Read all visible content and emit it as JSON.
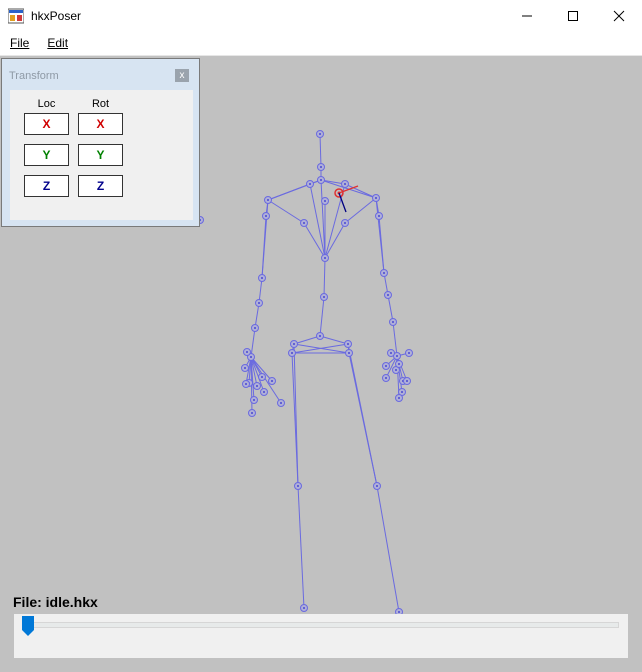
{
  "window": {
    "title": "hkxPoser",
    "app_icon": "hkxposer-app-icon",
    "controls": [
      "minimize-icon",
      "maximize-icon",
      "close-icon"
    ]
  },
  "menu": {
    "file_label": "File",
    "edit_label": "Edit"
  },
  "transform_panel": {
    "title": "Transform",
    "close_label": "x",
    "loc_label": "Loc",
    "rot_label": "Rot",
    "loc_x": "X",
    "loc_y": "Y",
    "loc_z": "Z",
    "rot_x": "X",
    "rot_y": "Y",
    "rot_z": "Z"
  },
  "status": {
    "file_text": "File: idle.hkx"
  },
  "timeline": {
    "position": 0
  },
  "colors": {
    "viewport_bg": "#c1c1c1",
    "bone": "#6a6ae0",
    "selected_bone": "#e03030",
    "axis_x": "#d00000",
    "axis_y": "#008000",
    "axis_z": "#00008b",
    "slider_thumb": "#0078d7"
  }
}
